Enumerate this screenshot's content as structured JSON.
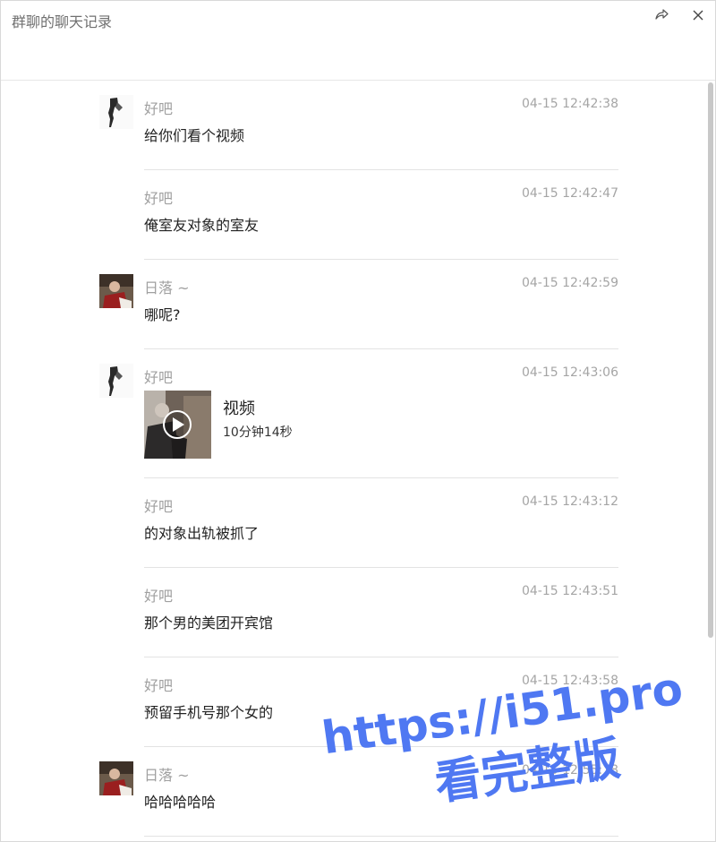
{
  "window": {
    "title": "群聊的聊天记录"
  },
  "messages": [
    {
      "sender": "好吧",
      "time": "04-15 12:42:38",
      "text": "给你们看个视频"
    },
    {
      "sender": "好吧",
      "time": "04-15 12:42:47",
      "text": "俺室友对象的室友"
    },
    {
      "sender": "日落 ~",
      "time": "04-15 12:42:59",
      "text": "哪呢?"
    },
    {
      "sender": "好吧",
      "time": "04-15 12:43:06",
      "video": {
        "title": "视频",
        "duration": "10分钟14秒"
      }
    },
    {
      "sender": "好吧",
      "time": "04-15 12:43:12",
      "text": "的对象出轨被抓了"
    },
    {
      "sender": "好吧",
      "time": "04-15 12:43:51",
      "text": "那个男的美团开宾馆"
    },
    {
      "sender": "好吧",
      "time": "04-15 12:43:58",
      "text": "预留手机号那个女的"
    },
    {
      "sender": "日落 ~",
      "time": "04-15 12:55:18",
      "text": "哈哈哈哈哈"
    }
  ],
  "watermark": {
    "line1": "https://i51.pro",
    "line2": "看完整版",
    "color": "#4f78f2"
  },
  "icons": {
    "share": "share-arrow-icon",
    "close": "close-icon"
  }
}
